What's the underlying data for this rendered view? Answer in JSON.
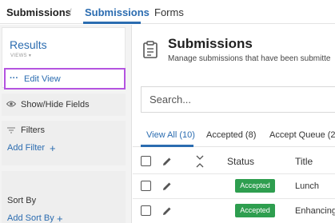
{
  "nav": {
    "root_label": "Submissions",
    "separator": "/",
    "active_label": "Submissions",
    "forms_label": "Forms"
  },
  "sidebar": {
    "views_title": "Results",
    "views_sub": "VIEWS",
    "edit_view_label": "Edit View",
    "edit_view_dots": "···",
    "show_hide_label": "Show/Hide Fields",
    "filters_label": "Filters",
    "add_filter_label": "Add Filter",
    "sort_by_label": "Sort By",
    "add_sort_label": "Add Sort By",
    "plus_symbol": "+"
  },
  "main": {
    "title": "Submissions",
    "subtitle": "Manage submissions that have been submitte",
    "search_placeholder": "Search...",
    "tabs": [
      {
        "label": "View All (10)"
      },
      {
        "label": "Accepted (8)"
      },
      {
        "label": "Accept Queue (2)"
      }
    ],
    "columns": {
      "status": "Status",
      "title": "Title"
    },
    "rows": [
      {
        "status": "Accepted",
        "title": "Lunch"
      },
      {
        "status": "Accepted",
        "title": "Enhancing"
      }
    ]
  },
  "colors": {
    "accent": "#2b6cb0",
    "highlight_border": "#b454e0",
    "badge_green": "#2e9e4f"
  },
  "icons": [
    "eye-icon",
    "filter-icon",
    "clipboard-icon",
    "pencil-icon",
    "sort-arrows-icon",
    "chevron-down-icon"
  ]
}
